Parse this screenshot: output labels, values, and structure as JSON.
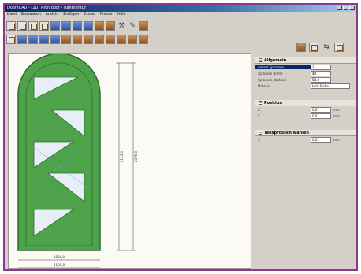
{
  "window": {
    "title": "DoorsCAD - [2D] Arch door - Rahmentür"
  },
  "menu": [
    "Datei",
    "Bearbeiten",
    "Ansicht",
    "Einfügen",
    "Extras",
    "Fenster",
    "Hilfe"
  ],
  "toolbar1": [
    {
      "icon": "door-view-icon",
      "style": "win"
    },
    {
      "icon": "door-view-icon",
      "style": "win"
    },
    {
      "icon": "door-view-icon",
      "style": "win"
    },
    {
      "icon": "door-view-icon",
      "style": "win"
    },
    {
      "icon": "blue-door-icon",
      "style": "blue"
    },
    {
      "icon": "blue-door-icon",
      "style": "blue"
    },
    {
      "icon": "blue-door-icon",
      "style": "blue"
    },
    {
      "icon": "blue-door-icon",
      "style": "blue"
    },
    {
      "icon": "brown-door-icon",
      "style": "brown"
    },
    {
      "icon": "brown-door-icon",
      "style": "brown"
    },
    {
      "icon": "hammer-icon",
      "style": "glyph"
    },
    {
      "icon": "tools-icon",
      "style": "glyph"
    },
    {
      "icon": "paint-icon",
      "style": "brown"
    }
  ],
  "toolbar2": [
    {
      "icon": "frame-icon",
      "style": "win"
    },
    {
      "icon": "panel-icon",
      "style": "blue"
    },
    {
      "icon": "panel-icon",
      "style": "blue"
    },
    {
      "icon": "panel-icon",
      "style": "blue"
    },
    {
      "icon": "panel-icon",
      "style": "blue"
    },
    {
      "icon": "panel-icon",
      "style": "brown"
    },
    {
      "icon": "panel-icon",
      "style": "brown"
    },
    {
      "icon": "panel-icon",
      "style": "brown"
    },
    {
      "icon": "panel-icon",
      "style": "brown"
    },
    {
      "icon": "panel-icon",
      "style": "brown"
    },
    {
      "icon": "panel-icon",
      "style": "brown"
    },
    {
      "icon": "panel-icon",
      "style": "brown"
    },
    {
      "icon": "panel-icon",
      "style": "brown"
    }
  ],
  "right_tools": [
    "book-icon",
    "print-icon",
    "arrow-icon",
    "window-icon"
  ],
  "dimensions": {
    "height_outer": "2145,0",
    "height_inner": "2095,0",
    "width_inner": "1000,0",
    "width_outer": "1100,0"
  },
  "panel": {
    "general": {
      "title": "Allgemein",
      "rows": [
        {
          "label": "Anzahl Sprossen",
          "value": "3"
        },
        {
          "label": "Sprossen Breite",
          "value": "40"
        },
        {
          "label": "Sprossen Abstand",
          "value": "50,0"
        },
        {
          "label": "Material",
          "value": "Holz Eiche"
        }
      ]
    },
    "position": {
      "title": "Position",
      "rows": [
        {
          "label": "X",
          "value": "0,0",
          "unit": "mm"
        },
        {
          "label": "Y",
          "value": "0,0",
          "unit": "mm"
        }
      ]
    },
    "offset": {
      "title": "Teilsprossen wählen",
      "rows": [
        {
          "label": "X",
          "value": "0,0",
          "unit": "mm"
        }
      ]
    }
  },
  "colors": {
    "door_green": "#4ea34a",
    "door_edge": "#2d6a2a",
    "glass": "#e8eef5",
    "window_border": "#8b3a8b"
  }
}
